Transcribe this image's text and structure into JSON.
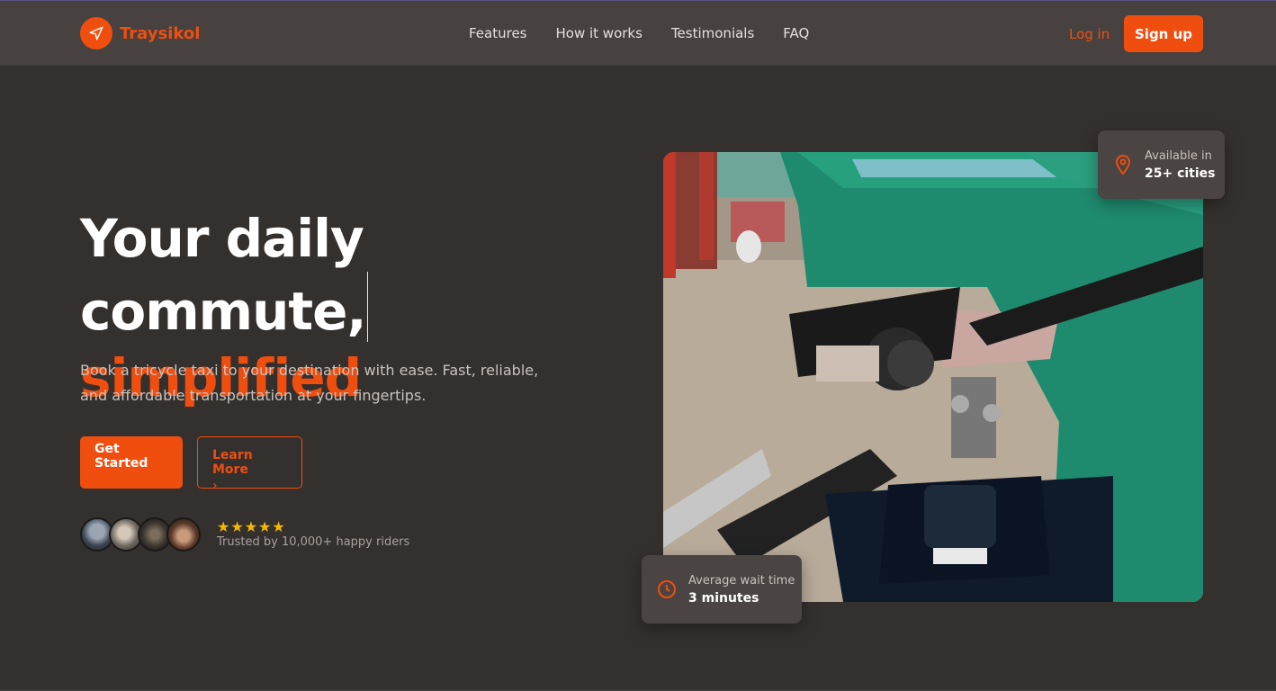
{
  "brand": {
    "name": "Traysikol",
    "accent_color": "#f04e0f",
    "logo_icon": "navigation-arrow-icon"
  },
  "nav": {
    "items": [
      {
        "label": "Features"
      },
      {
        "label": "How it works"
      },
      {
        "label": "Testimonials"
      },
      {
        "label": "FAQ"
      }
    ],
    "login_label": "Log in",
    "signup_label": "Sign up"
  },
  "hero": {
    "title_line1": "Your daily commute,",
    "title_line2": "simplified",
    "subtitle": "Book a tricycle taxi to your destination with ease. Fast, reliable, and affordable transportation at your fingertips.",
    "primary_button": "Get Started",
    "secondary_button": "Learn More",
    "secondary_chevron": "›",
    "rating_stars": "★★★★★",
    "rating_count": 5,
    "trust_text": "Trusted by 10,000+ happy riders"
  },
  "stats": {
    "cities": {
      "label": "Available in",
      "value": "25+ cities",
      "icon": "map-pin-icon"
    },
    "wait": {
      "label": "Average wait time",
      "value": "3 minutes",
      "icon": "clock-icon"
    }
  }
}
